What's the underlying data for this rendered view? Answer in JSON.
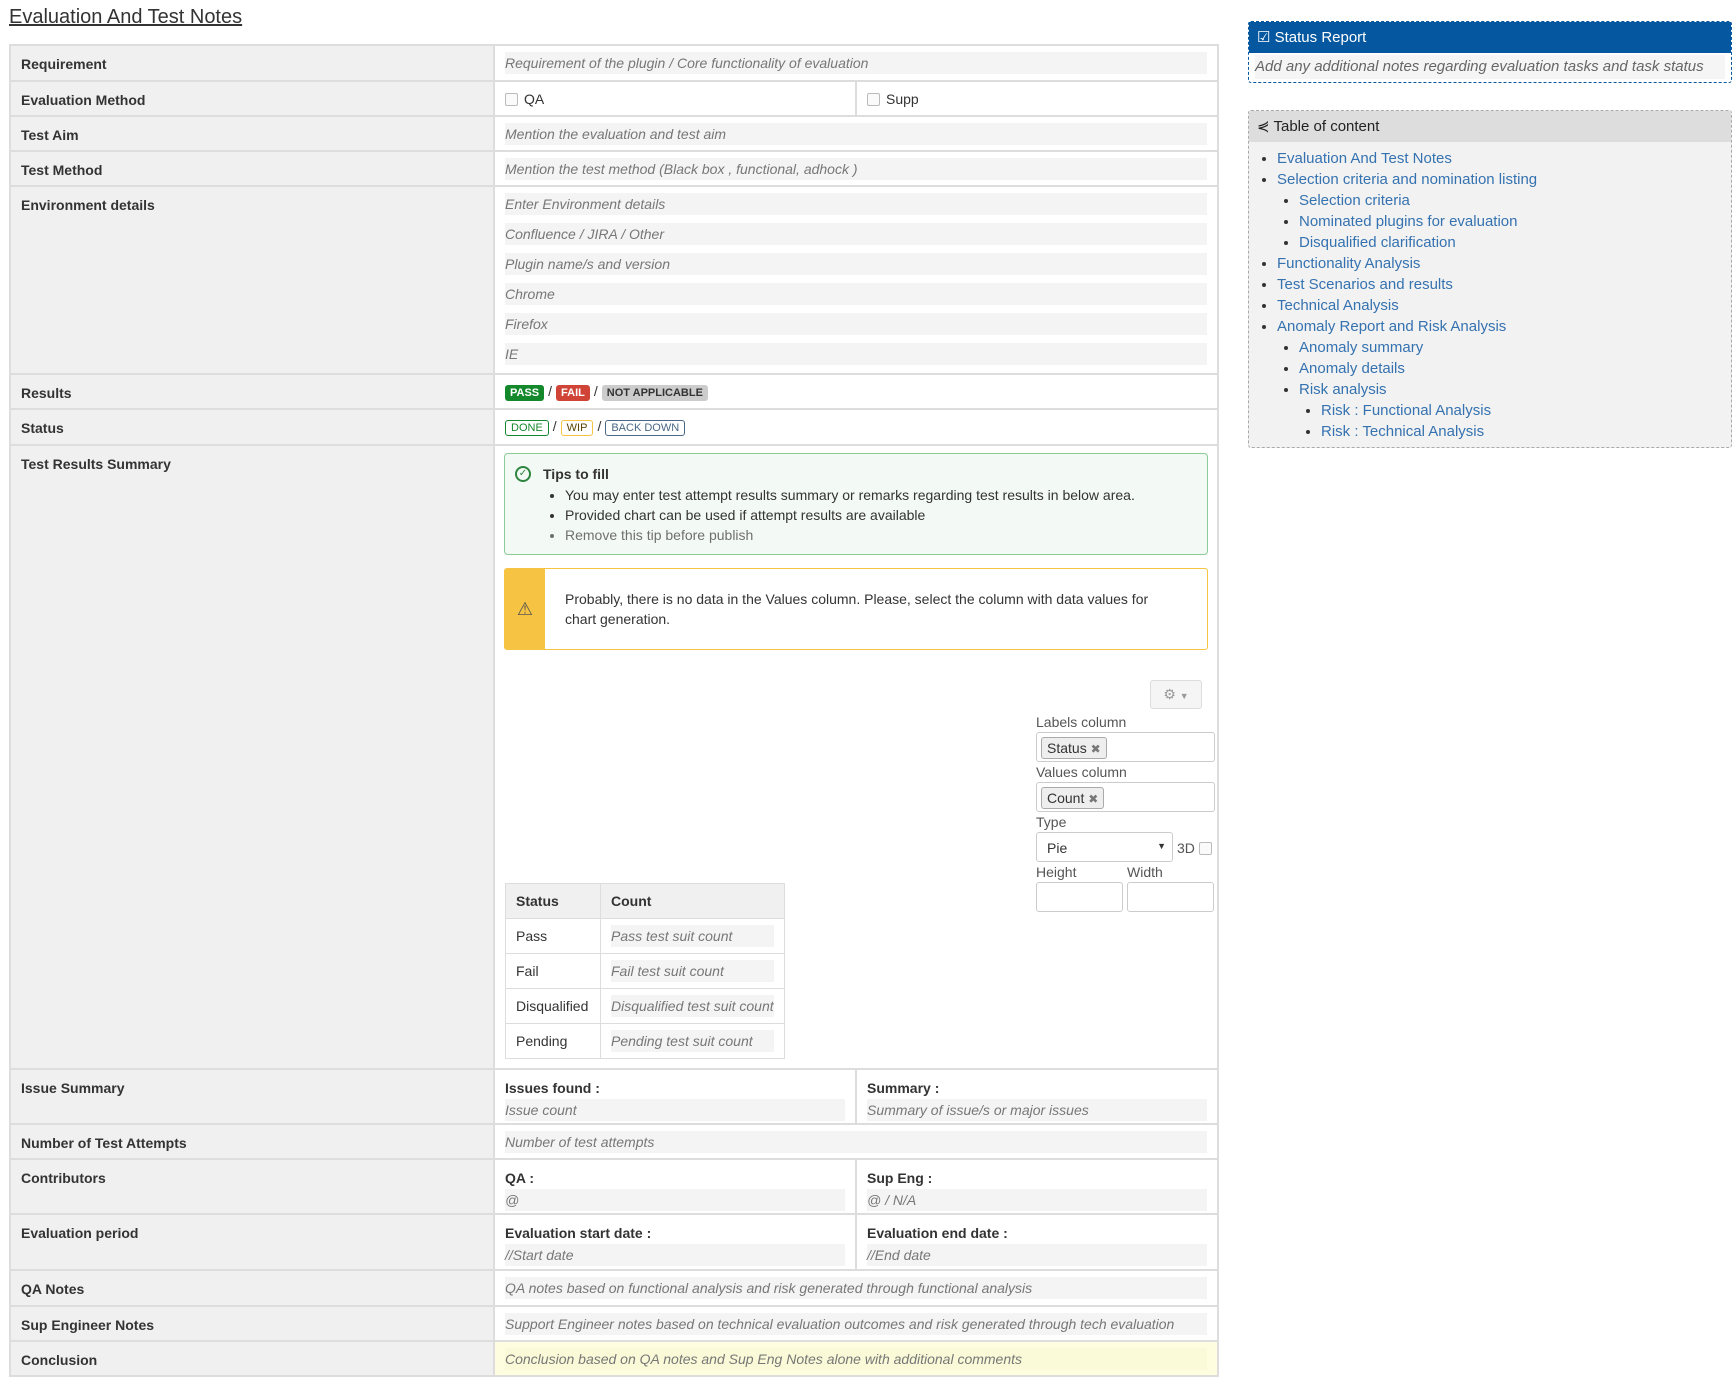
{
  "title": "Evaluation And Test Notes",
  "rows": {
    "requirement": {
      "label": "Requirement",
      "placeholder": "Requirement of the plugin / Core functionality of evaluation"
    },
    "eval_method": {
      "label": "Evaluation Method",
      "options": [
        "QA",
        "Supp"
      ]
    },
    "test_aim": {
      "label": "Test Aim",
      "placeholder": "Mention the evaluation and test aim"
    },
    "test_method": {
      "label": "Test Method",
      "placeholder": "Mention the test method (Black box , functional, adhock )"
    },
    "environment": {
      "label": "Environment details",
      "fields": [
        "Enter Environment details",
        "Confluence / JIRA / Other",
        "Plugin name/s and version",
        "Chrome",
        "Firefox",
        "IE"
      ]
    },
    "results": {
      "label": "Results",
      "badges": [
        "PASS",
        "FAIL",
        "NOT APPLICABLE"
      ],
      "sep": "/"
    },
    "status": {
      "label": "Status",
      "badges": [
        "DONE",
        "WIP",
        "BACK DOWN"
      ]
    },
    "summary": {
      "label": "Test Results Summary",
      "tips": {
        "title": "Tips to fill",
        "items": [
          "You may enter test attempt results summary or remarks regarding test results in below area.",
          "Provided chart can be used if attempt results are available",
          "Remove this tip before publish"
        ]
      },
      "warning": "Probably, there is no data in the Values column. Please, select the column with data values for chart generation.",
      "chart_settings": {
        "labels_column_label": "Labels column",
        "labels_column": "Status",
        "values_column_label": "Values column",
        "values_column": "Count",
        "type_label": "Type",
        "type": "Pie",
        "three_d_label": "3D",
        "height_label": "Height",
        "width_label": "Width"
      },
      "table": {
        "headers": [
          "Status",
          "Count"
        ],
        "rows": [
          [
            "Pass",
            "Pass test suit count"
          ],
          [
            "Fail",
            "Fail test suit count"
          ],
          [
            "Disqualified",
            "Disqualified test suit count"
          ],
          [
            "Pending",
            "Pending test suit count"
          ]
        ]
      }
    },
    "issue_summary": {
      "label": "Issue Summary",
      "left_title": "Issues found :",
      "left_ph": "Issue count",
      "right_title": "Summary :",
      "right_ph": "Summary of issue/s or major issues"
    },
    "attempts": {
      "label": "Number of Test Attempts",
      "placeholder": "Number of test attempts"
    },
    "contributors": {
      "label": "Contributors",
      "left_title": "QA :",
      "left_ph": "@",
      "right_title": "Sup Eng :",
      "right_ph": "@ / N/A"
    },
    "period": {
      "label": "Evaluation period",
      "left_title": "Evaluation start date :",
      "left_ph": "//Start date",
      "right_title": "Evaluation end date :",
      "right_ph": "//End date"
    },
    "qa_notes": {
      "label": "QA Notes",
      "placeholder": "QA notes based on functional analysis and risk generated through functional analysis"
    },
    "sup_notes": {
      "label": "Sup Engineer Notes",
      "placeholder": "Support Engineer notes based on technical evaluation outcomes and risk generated through tech evaluation"
    },
    "conclusion": {
      "label": "Conclusion",
      "placeholder": "Conclusion based on QA notes and Sup Eng Notes alone with additional comments"
    }
  },
  "status_report": {
    "title": "Status Report",
    "placeholder": "Add any additional notes regarding evaluation tasks and task status"
  },
  "toc": {
    "title": "Table of content",
    "items": [
      "Evaluation And Test Notes",
      "Selection criteria and nomination listing",
      "Selection criteria",
      "Nominated plugins for evaluation",
      "Disqualified clarification",
      "Functionality Analysis",
      "Test Scenarios and results",
      "Technical Analysis",
      "Anomaly Report and Risk Analysis",
      "Anomaly summary",
      "Anomaly details",
      "Risk analysis",
      "Risk : Functional Analysis",
      "Risk : Technical Analysis"
    ]
  },
  "colors": {
    "pass": "#14892c",
    "fail": "#d04437",
    "na": "#ccc",
    "brand": "#0558a0",
    "link": "#3572b0"
  }
}
